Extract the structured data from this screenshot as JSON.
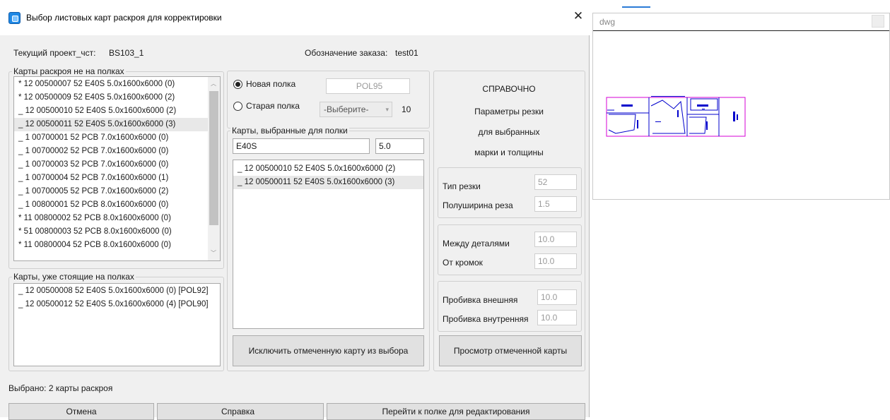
{
  "window": {
    "title": "Выбор листовых карт раскроя для корректировки",
    "close_label": "✕"
  },
  "project": {
    "label": "Текущий проект_чст:",
    "value": "BS103_1",
    "order_label": "Обозначение заказа:",
    "order_value": "test01"
  },
  "not_on_shelves": {
    "caption": "Карты раскроя не на полках",
    "items": [
      "* 12 00500007 52 E40S 5.0x1600x6000 (0)",
      "* 12 00500009 52 E40S 5.0x1600x6000 (2)",
      "_ 12 00500010 52 E40S 5.0x1600x6000 (2)",
      "_ 12 00500011 52 E40S 5.0x1600x6000 (3)",
      "_ 1 00700001 52 PCB 7.0x1600x6000 (0)",
      "_ 1 00700002 52 PCB 7.0x1600x6000 (0)",
      "_ 1 00700003 52 PCB 7.0x1600x6000 (0)",
      "_ 1 00700004 52 PCB 7.0x1600x6000 (1)",
      "_ 1 00700005 52 PCB 7.0x1600x6000 (2)",
      "_ 1 00800001 52 PCB 8.0x1600x6000 (0)",
      "* 11 00800002 52 PCB 8.0x1600x6000 (0)",
      "* 51 00800003 52 PCB 8.0x1600x6000 (0)",
      "* 11 00800004 52 PCB 8.0x1600x6000 (0)"
    ],
    "selected_index": 3
  },
  "on_shelves": {
    "caption": "Карты, уже стоящие на полках",
    "items": [
      "_ 12 00500008 52 E40S 5.0x1600x6000 (0) [POL92]",
      "_ 12 00500012 52 E40S 5.0x1600x6000 (4) [POL90]"
    ]
  },
  "shelf": {
    "new_label": "Новая полка",
    "new_value": "POL95",
    "old_label": "Старая полка",
    "old_select": "-Выберите-",
    "old_count": "10",
    "selected_option": "new"
  },
  "selected_for_shelf": {
    "caption": "Карты, выбранные для полки",
    "grade": "E40S",
    "thickness": "5.0",
    "items": [
      "_ 12 00500010 52 E40S 5.0x1600x6000 (2)",
      "_ 12 00500011 52 E40S 5.0x1600x6000 (3)"
    ],
    "selected_index": 1,
    "exclude_button": "Исключить отмеченную карту из выбора"
  },
  "reference": {
    "line1": "СПРАВОЧНО",
    "line2": "Параметры резки",
    "line3": "для выбранных",
    "line4": "марки и толщины",
    "cut_type_label": "Тип резки",
    "cut_type_value": "52",
    "half_width_label": "Полуширина реза",
    "half_width_value": "1.5",
    "between_parts_label": "Между деталями",
    "between_parts_value": "10.0",
    "from_edges_label": "От кромок",
    "from_edges_value": "10.0",
    "pierce_outer_label": "Пробивка внешняя",
    "pierce_outer_value": "10.0",
    "pierce_inner_label": "Пробивка внутренняя",
    "pierce_inner_value": "10.0",
    "view_button": "Просмотр отмеченной карты"
  },
  "status": {
    "text": "Выбрано: 2 карты раскроя"
  },
  "footer": {
    "cancel": "Отмена",
    "help": "Справка",
    "go_to_shelf": "Перейти к полке для редактирования"
  },
  "dwg": {
    "title": "dwg"
  },
  "colors": {
    "drawing_border": "#d400d4",
    "drawing_lines": "#0000cc",
    "selection": "#e8e8e8"
  }
}
